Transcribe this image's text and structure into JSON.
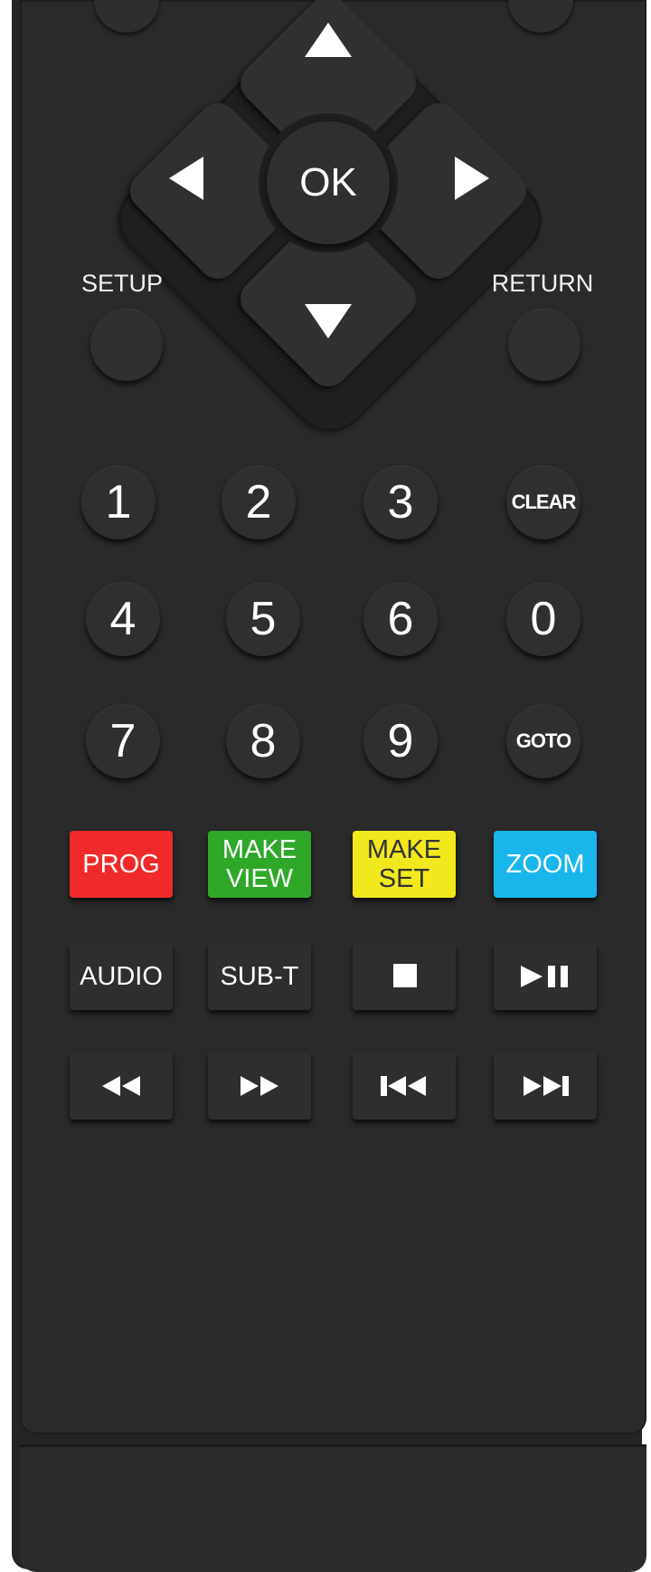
{
  "remote": {
    "dpad": {
      "ok_label": "OK"
    },
    "setup_label": "SETUP",
    "return_label": "RETURN",
    "numbers": [
      "1",
      "2",
      "3",
      "4",
      "5",
      "6",
      "7",
      "8",
      "9",
      "0"
    ],
    "clear_label": "CLEAR",
    "goto_label": "GOTO",
    "color_buttons": [
      {
        "label": "PROG",
        "color": "#f02a2a"
      },
      {
        "label": "MAKE\nVIEW",
        "color": "#2fa82a"
      },
      {
        "label": "MAKE\nSET",
        "color": "#f2e81e"
      },
      {
        "label": "ZOOM",
        "color": "#18b6ea"
      }
    ],
    "audio_label": "AUDIO",
    "subt_label": "SUB-T",
    "icons": [
      "stop-icon",
      "play-pause-icon",
      "rewind-icon",
      "fast-forward-icon",
      "previous-icon",
      "next-icon"
    ]
  }
}
